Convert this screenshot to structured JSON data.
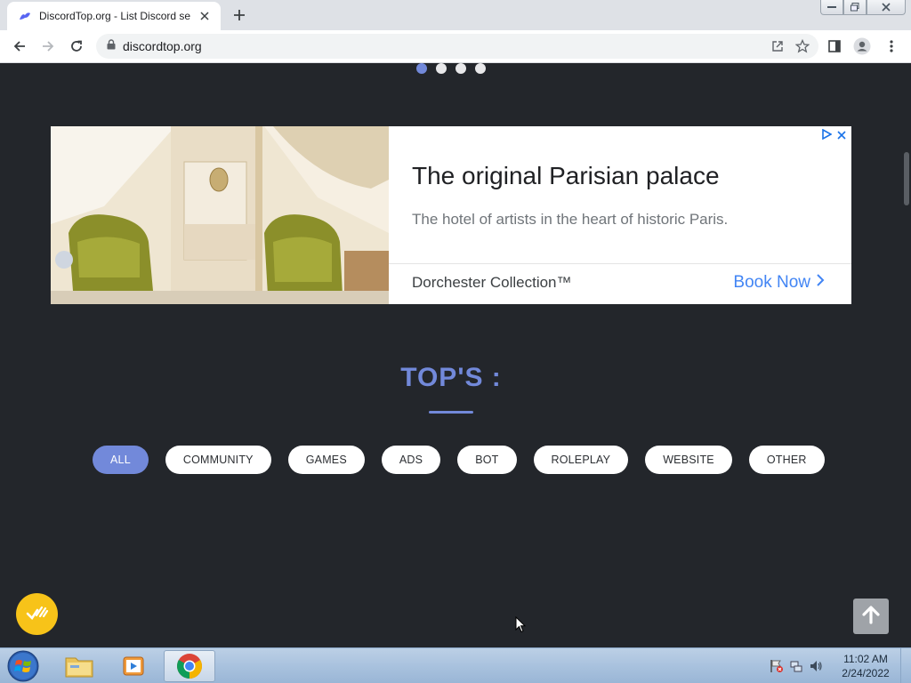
{
  "browser": {
    "tab_title": "DiscordTop.org - List Discord ser",
    "url": "discordtop.org"
  },
  "carousel": {
    "dots": [
      true,
      false,
      false,
      false
    ]
  },
  "ad": {
    "title": "The original Parisian palace",
    "description": "The hotel of artists in the heart of historic Paris.",
    "brand": "Dorchester Collection™",
    "cta": "Book Now"
  },
  "section": {
    "title": "TOP'S :"
  },
  "filters": [
    {
      "label": "ALL",
      "active": true
    },
    {
      "label": "COMMUNITY",
      "active": false
    },
    {
      "label": "GAMES",
      "active": false
    },
    {
      "label": "ADS",
      "active": false
    },
    {
      "label": "BOT",
      "active": false
    },
    {
      "label": "ROLEPLAY",
      "active": false
    },
    {
      "label": "WEBSITE",
      "active": false
    },
    {
      "label": "OTHER",
      "active": false
    }
  ],
  "taskbar": {
    "time": "11:02 AM",
    "date": "2/24/2022"
  },
  "colors": {
    "accent": "#7289da",
    "page_bg": "#23262b",
    "cta_blue": "#4285f4",
    "fab_yellow": "#f7c319"
  }
}
